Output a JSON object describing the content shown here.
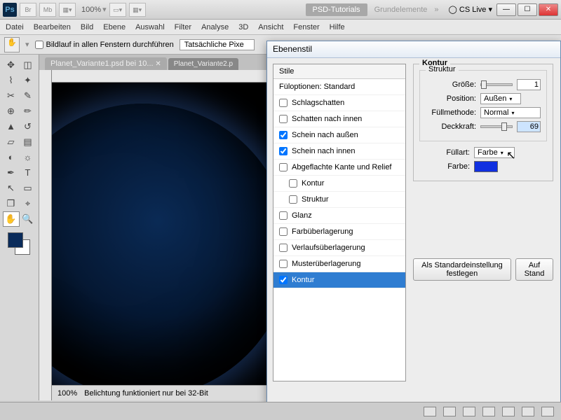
{
  "titlebar": {
    "ps": "Ps",
    "br": "Br",
    "mb": "Mb",
    "zoom": "100%",
    "workspace1": "PSD-Tutorials",
    "workspace2": "Grundelemente",
    "cslive": "CS Live"
  },
  "menu": [
    "Datei",
    "Bearbeiten",
    "Bild",
    "Ebene",
    "Auswahl",
    "Filter",
    "Analyse",
    "3D",
    "Ansicht",
    "Fenster",
    "Hilfe"
  ],
  "optbar": {
    "scroll_all": "Bildlauf in allen Fenstern durchführen",
    "actual": "Tatsächliche Pixe"
  },
  "tabs": {
    "t1": "Planet_Variante1.psd bei 10...",
    "t2": "Planet_Variante2.p"
  },
  "status": {
    "zoom": "100%",
    "msg": "Belichtung funktioniert nur bei 32-Bit"
  },
  "dialog": {
    "title": "Ebenenstil",
    "styles_header": "Stile",
    "items": {
      "fill": "Füloptionen: Standard",
      "drop": "Schlagschatten",
      "inner": "Schatten nach innen",
      "outerglow": "Schein nach außen",
      "innerglow": "Schein nach innen",
      "bevel": "Abgeflachte Kante und Relief",
      "kontur_sub": "Kontur",
      "struktur_sub": "Struktur",
      "glanz": "Glanz",
      "colorover": "Farbüberlagerung",
      "gradover": "Verlaufsüberlagerung",
      "patover": "Musterüberlagerung",
      "kontur": "Kontur"
    },
    "panel": {
      "group": "Kontur",
      "sub": "Struktur",
      "size": "Größe:",
      "size_val": "1",
      "position": "Position:",
      "position_val": "Außen",
      "blend": "Füllmethode:",
      "blend_val": "Normal",
      "opacity": "Deckkraft:",
      "opacity_val": "69",
      "filltype": "Füllart:",
      "filltype_val": "Farbe",
      "color": "Farbe:",
      "btn_default": "Als Standardeinstellung festlegen",
      "btn_reset": "Auf Stand"
    }
  }
}
